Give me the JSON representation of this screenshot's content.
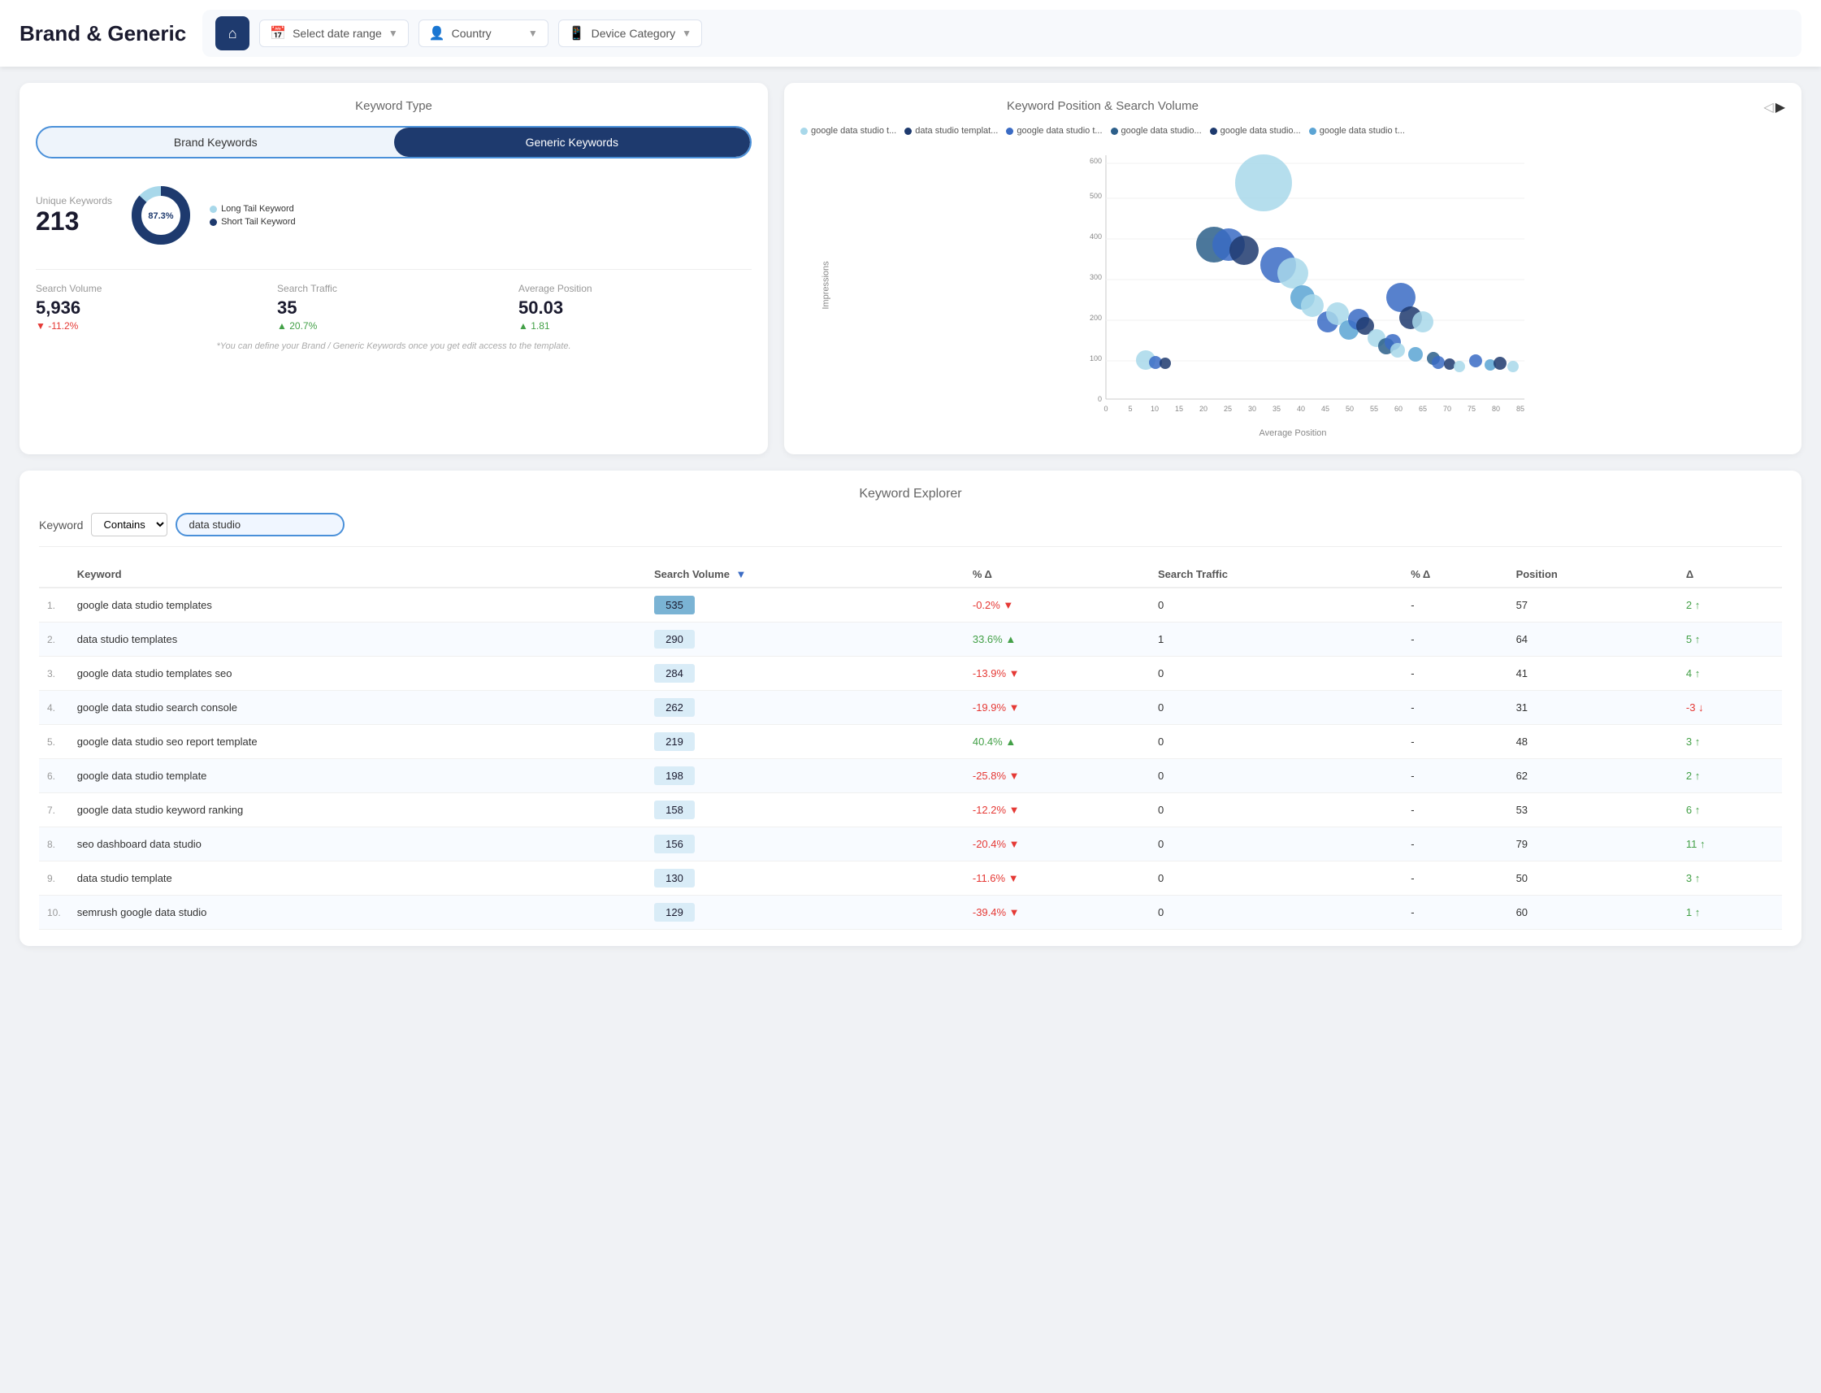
{
  "header": {
    "title": "Brand & Generic",
    "home_icon": "🏠",
    "date_range_label": "Select date range",
    "country_label": "Country",
    "device_label": "Device Category"
  },
  "keyword_type_card": {
    "title": "Keyword Type",
    "btn_brand": "Brand Keywords",
    "btn_generic": "Generic Keywords",
    "unique_label": "Unique Keywords",
    "unique_value": "213",
    "donut_percent": "87.3%",
    "legend_long": "Long Tail Keyword",
    "legend_short": "Short Tail Keyword",
    "search_volume_label": "Search Volume",
    "search_volume_value": "5,936",
    "search_volume_change": "▼ -11.2%",
    "search_traffic_label": "Search Traffic",
    "search_traffic_value": "35",
    "search_traffic_change": "▲ 20.7%",
    "avg_position_label": "Average Position",
    "avg_position_value": "50.03",
    "avg_position_change": "▲ 1.81",
    "footnote": "*You can define your Brand / Generic Keywords once you get edit access to the template."
  },
  "scatter_chart": {
    "title": "Keyword Position & Search Volume",
    "x_label": "Average Position",
    "y_label": "Impressions",
    "legend": [
      {
        "label": "google data studio t...",
        "color": "#a8d8ea"
      },
      {
        "label": "data studio templat...",
        "color": "#1e3a6e"
      },
      {
        "label": "google data studio t...",
        "color": "#3a6bc4"
      },
      {
        "label": "google data studio...",
        "color": "#2c5f8a"
      },
      {
        "label": "google data studio...",
        "color": "#1e3a6e"
      },
      {
        "label": "google data studio t...",
        "color": "#5ba4d4"
      }
    ],
    "y_ticks": [
      "0",
      "100",
      "200",
      "300",
      "400",
      "500",
      "600"
    ],
    "x_ticks": [
      "0",
      "5",
      "10",
      "15",
      "20",
      "25",
      "30",
      "35",
      "40",
      "45",
      "50",
      "55",
      "60",
      "65",
      "70",
      "75",
      "80",
      "85"
    ],
    "bubbles": [
      {
        "x": 8,
        "y": 95,
        "r": 12,
        "color": "#a8d8ea"
      },
      {
        "x": 10,
        "y": 90,
        "r": 8,
        "color": "#3a6bc4"
      },
      {
        "x": 12,
        "y": 88,
        "r": 7,
        "color": "#1e3a6e"
      },
      {
        "x": 22,
        "y": 380,
        "r": 30,
        "color": "#2c5f8a"
      },
      {
        "x": 25,
        "y": 380,
        "r": 26,
        "color": "#3a6bc4"
      },
      {
        "x": 28,
        "y": 365,
        "r": 22,
        "color": "#1e3a6e"
      },
      {
        "x": 32,
        "y": 530,
        "r": 45,
        "color": "#a8d8ea"
      },
      {
        "x": 35,
        "y": 330,
        "r": 28,
        "color": "#3a6bc4"
      },
      {
        "x": 38,
        "y": 310,
        "r": 24,
        "color": "#a8d8ea"
      },
      {
        "x": 40,
        "y": 250,
        "r": 18,
        "color": "#5ba4d4"
      },
      {
        "x": 42,
        "y": 230,
        "r": 16,
        "color": "#a8d8ea"
      },
      {
        "x": 45,
        "y": 190,
        "r": 14,
        "color": "#3a6bc4"
      },
      {
        "x": 48,
        "y": 220,
        "r": 17,
        "color": "#a8d8ea"
      },
      {
        "x": 50,
        "y": 170,
        "r": 13,
        "color": "#5ba4d4"
      },
      {
        "x": 52,
        "y": 200,
        "r": 15,
        "color": "#3a6bc4"
      },
      {
        "x": 53,
        "y": 180,
        "r": 12,
        "color": "#1e3a6e"
      },
      {
        "x": 55,
        "y": 150,
        "r": 11,
        "color": "#a8d8ea"
      },
      {
        "x": 57,
        "y": 130,
        "r": 10,
        "color": "#2c5f8a"
      },
      {
        "x": 58,
        "y": 140,
        "r": 10,
        "color": "#3a6bc4"
      },
      {
        "x": 59,
        "y": 120,
        "r": 9,
        "color": "#a8d8ea"
      },
      {
        "x": 60,
        "y": 250,
        "r": 22,
        "color": "#3a6bc4"
      },
      {
        "x": 62,
        "y": 200,
        "r": 16,
        "color": "#1e3a6e"
      },
      {
        "x": 63,
        "y": 110,
        "r": 9,
        "color": "#5ba4d4"
      },
      {
        "x": 65,
        "y": 190,
        "r": 14,
        "color": "#a8d8ea"
      },
      {
        "x": 67,
        "y": 100,
        "r": 8,
        "color": "#2c5f8a"
      },
      {
        "x": 68,
        "y": 90,
        "r": 8,
        "color": "#3a6bc4"
      },
      {
        "x": 70,
        "y": 85,
        "r": 7,
        "color": "#1e3a6e"
      },
      {
        "x": 72,
        "y": 80,
        "r": 7,
        "color": "#a8d8ea"
      },
      {
        "x": 75,
        "y": 95,
        "r": 8,
        "color": "#3a6bc4"
      },
      {
        "x": 78,
        "y": 85,
        "r": 7,
        "color": "#5ba4d4"
      },
      {
        "x": 80,
        "y": 90,
        "r": 8,
        "color": "#1e3a6e"
      },
      {
        "x": 83,
        "y": 80,
        "r": 7,
        "color": "#a8d8ea"
      }
    ]
  },
  "explorer": {
    "title": "Keyword Explorer",
    "filter_label": "Keyword",
    "filter_type": "Contains",
    "filter_value": "data studio",
    "columns": [
      "Keyword",
      "Search Volume",
      "% Δ",
      "Search Traffic",
      "% Δ",
      "Position",
      "Δ"
    ],
    "rows": [
      {
        "num": "1.",
        "keyword": "google data studio templates",
        "search_volume": "535",
        "sv_change": "-0.2%",
        "sv_dir": "down",
        "traffic": "0",
        "traffic_change": "-",
        "position": "57",
        "pos_change": "2",
        "pos_dir": "up"
      },
      {
        "num": "2.",
        "keyword": "data studio templates",
        "search_volume": "290",
        "sv_change": "33.6%",
        "sv_dir": "up",
        "traffic": "1",
        "traffic_change": "-",
        "position": "64",
        "pos_change": "5",
        "pos_dir": "up"
      },
      {
        "num": "3.",
        "keyword": "google data studio templates seo",
        "search_volume": "284",
        "sv_change": "-13.9%",
        "sv_dir": "down",
        "traffic": "0",
        "traffic_change": "-",
        "position": "41",
        "pos_change": "4",
        "pos_dir": "up"
      },
      {
        "num": "4.",
        "keyword": "google data studio search console",
        "search_volume": "262",
        "sv_change": "-19.9%",
        "sv_dir": "down",
        "traffic": "0",
        "traffic_change": "-",
        "position": "31",
        "pos_change": "-3",
        "pos_dir": "down"
      },
      {
        "num": "5.",
        "keyword": "google data studio seo report template",
        "search_volume": "219",
        "sv_change": "40.4%",
        "sv_dir": "up",
        "traffic": "0",
        "traffic_change": "-",
        "position": "48",
        "pos_change": "3",
        "pos_dir": "up"
      },
      {
        "num": "6.",
        "keyword": "google data studio template",
        "search_volume": "198",
        "sv_change": "-25.8%",
        "sv_dir": "down",
        "traffic": "0",
        "traffic_change": "-",
        "position": "62",
        "pos_change": "2",
        "pos_dir": "up"
      },
      {
        "num": "7.",
        "keyword": "google data studio keyword ranking",
        "search_volume": "158",
        "sv_change": "-12.2%",
        "sv_dir": "down",
        "traffic": "0",
        "traffic_change": "-",
        "position": "53",
        "pos_change": "6",
        "pos_dir": "up"
      },
      {
        "num": "8.",
        "keyword": "seo dashboard data studio",
        "search_volume": "156",
        "sv_change": "-20.4%",
        "sv_dir": "down",
        "traffic": "0",
        "traffic_change": "-",
        "position": "79",
        "pos_change": "11",
        "pos_dir": "up"
      },
      {
        "num": "9.",
        "keyword": "data studio template",
        "search_volume": "130",
        "sv_change": "-11.6%",
        "sv_dir": "down",
        "traffic": "0",
        "traffic_change": "-",
        "position": "50",
        "pos_change": "3",
        "pos_dir": "up"
      },
      {
        "num": "10.",
        "keyword": "semrush google data studio",
        "search_volume": "129",
        "sv_change": "-39.4%",
        "sv_dir": "down",
        "traffic": "0",
        "traffic_change": "-",
        "position": "60",
        "pos_change": "1",
        "pos_dir": "up"
      }
    ]
  }
}
